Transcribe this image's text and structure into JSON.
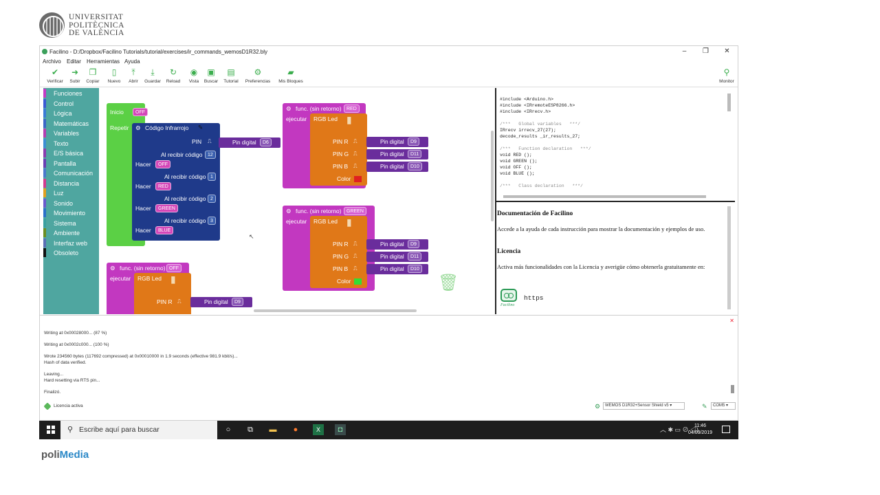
{
  "branding": {
    "university": [
      "UNIVERSITAT",
      "POLITÈCNICA",
      "DE VALÈNCIA"
    ],
    "footer_prefix": "poli",
    "footer_brand": "Media"
  },
  "window": {
    "title": "Facilino - D:/Dropbox/Facilino Tutorials/tutorial/exercises/ir_commands_wemosD1R32.bly",
    "controls": [
      "–",
      "❐",
      "✕"
    ]
  },
  "menu": [
    "Archivo",
    "Editar",
    "Herramientas",
    "Ayuda"
  ],
  "toolbar": {
    "verify": "Verificar",
    "upload": "Subir",
    "copy": "Copiar",
    "new": "Nuevo",
    "open": "Abrir",
    "save": "Guardar",
    "reload": "Reload",
    "view": "Vista",
    "find": "Buscar",
    "tutorial": "Tutorial",
    "prefs": "Preferencias",
    "myblocks": "Mis Bloques",
    "monitor": "Monitor"
  },
  "categories": [
    {
      "label": "Funciones",
      "color": "#c43bc4"
    },
    {
      "label": "Control",
      "color": "#3c5ad3"
    },
    {
      "label": "Lógica",
      "color": "#3a7bd5"
    },
    {
      "label": "Matemáticas",
      "color": "#3b66c7"
    },
    {
      "label": "Variables",
      "color": "#b53fb2"
    },
    {
      "label": "Texto",
      "color": "#3c8fd3"
    },
    {
      "label": "E/S básica",
      "color": "#8a3db0"
    },
    {
      "label": "Pantalla",
      "color": "#6a3fb4"
    },
    {
      "label": "Comunicación",
      "color": "#4b79cc"
    },
    {
      "label": "Distancia",
      "color": "#d23b8f"
    },
    {
      "label": "Luz",
      "color": "#e0a020"
    },
    {
      "label": "Sonido",
      "color": "#6a5acd"
    },
    {
      "label": "Movimiento",
      "color": "#2b70c8"
    },
    {
      "label": "Sistema",
      "color": "#3aa0a0"
    },
    {
      "label": "Ambiente",
      "color": "#6b8e23"
    },
    {
      "label": "Interfaz web",
      "color": "#5a6fb4"
    },
    {
      "label": "Obsoleto",
      "color": "#111111"
    }
  ],
  "blocks": {
    "inicio": "Inicio",
    "inicio_value": "OFF",
    "repetir": "Repetir",
    "ir": "Código Infrarrojo",
    "pin": "PIN",
    "pin_digital": "Pin digital",
    "ir_pin": "D6",
    "on_code": "Al recibir código",
    "hacer": "Hacer",
    "codes": [
      {
        "num": "12",
        "action": "OFF"
      },
      {
        "num": "1",
        "action": "RED"
      },
      {
        "num": "2",
        "action": "GREEN"
      },
      {
        "num": "3",
        "action": "BLUE"
      }
    ],
    "func_prefix": "func. (sin retorno)",
    "ejecutar": "ejecutar",
    "rgb": "RGB Led",
    "pin_r": "PIN R",
    "pin_g": "PIN G",
    "pin_b": "PIN B",
    "color": "Color",
    "f1": {
      "name": "RED",
      "pins": [
        "D9",
        "D11",
        "D10"
      ],
      "color": "#e02020"
    },
    "f2": {
      "name": "GREEN",
      "pins": [
        "D9",
        "D11",
        "D10"
      ],
      "color": "#33dd33"
    },
    "f3": {
      "name": "OFF",
      "pins": [
        "D9"
      ]
    }
  },
  "code": {
    "lines": [
      "#include <Arduino.h>",
      "#include <IRremoteESP8266.h>",
      "#include <IRrecv.h>",
      "",
      "/***   Global variables   ***/",
      "IRrecv irrecv_27(27);",
      "decode_results _ir_results_27;",
      "",
      "/***   Function declaration   ***/",
      "void RED ();",
      "void GREEN ();",
      "void OFF ();",
      "void BLUE ();",
      "",
      "/***   Class declaration   ***/"
    ]
  },
  "docs": {
    "title": "Documentación de Facilino",
    "text": "Accede a la ayuda de cada instrucción para mostrar la documentación y ejemplos de uso.",
    "license_title": "Licencia",
    "license_text": "Activa más funcionalidades con la Licencia y averigüe cómo obtenerla gratuitamente en:",
    "robot_label": "Facilino",
    "link": "https"
  },
  "console": {
    "lines": [
      "Writing at 0x00028000... (87 %)",
      "",
      "Writing at 0x0002c000... (100 %)",
      "",
      "Wrote 234560 bytes (117692 compressed) at 0x00010000 in 1.9 seconds (effective 981.9 kbit/s)...",
      "Hash of data verified.",
      "",
      "Leaving...",
      "Hard resetting via RTS pin...",
      "",
      "Finalizó."
    ]
  },
  "status": {
    "license": "Licencia activa",
    "board": "WEMOS D1R32+Sensor Shield v5",
    "port": "COM5"
  },
  "taskbar": {
    "search": "Escribe aquí para buscar",
    "time": "11:46",
    "date": "04/09/2019"
  }
}
